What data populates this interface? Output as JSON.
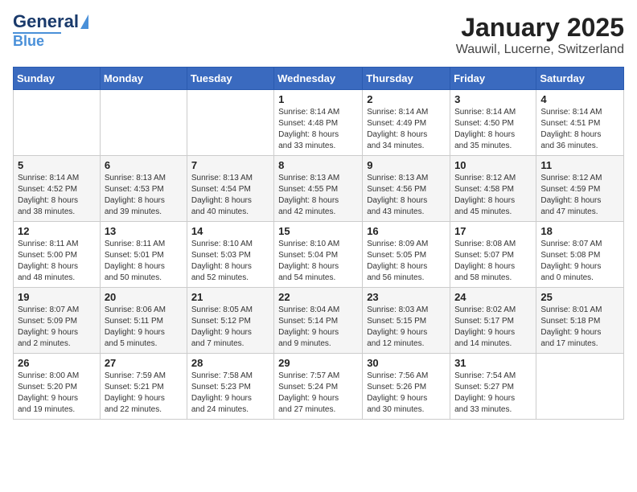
{
  "header": {
    "logo": {
      "line1": "General",
      "line2": "Blue"
    },
    "title": "January 2025",
    "subtitle": "Wauwil, Lucerne, Switzerland"
  },
  "weekdays": [
    "Sunday",
    "Monday",
    "Tuesday",
    "Wednesday",
    "Thursday",
    "Friday",
    "Saturday"
  ],
  "weeks": [
    [
      {
        "day": "",
        "info": ""
      },
      {
        "day": "",
        "info": ""
      },
      {
        "day": "",
        "info": ""
      },
      {
        "day": "1",
        "info": "Sunrise: 8:14 AM\nSunset: 4:48 PM\nDaylight: 8 hours\nand 33 minutes."
      },
      {
        "day": "2",
        "info": "Sunrise: 8:14 AM\nSunset: 4:49 PM\nDaylight: 8 hours\nand 34 minutes."
      },
      {
        "day": "3",
        "info": "Sunrise: 8:14 AM\nSunset: 4:50 PM\nDaylight: 8 hours\nand 35 minutes."
      },
      {
        "day": "4",
        "info": "Sunrise: 8:14 AM\nSunset: 4:51 PM\nDaylight: 8 hours\nand 36 minutes."
      }
    ],
    [
      {
        "day": "5",
        "info": "Sunrise: 8:14 AM\nSunset: 4:52 PM\nDaylight: 8 hours\nand 38 minutes."
      },
      {
        "day": "6",
        "info": "Sunrise: 8:13 AM\nSunset: 4:53 PM\nDaylight: 8 hours\nand 39 minutes."
      },
      {
        "day": "7",
        "info": "Sunrise: 8:13 AM\nSunset: 4:54 PM\nDaylight: 8 hours\nand 40 minutes."
      },
      {
        "day": "8",
        "info": "Sunrise: 8:13 AM\nSunset: 4:55 PM\nDaylight: 8 hours\nand 42 minutes."
      },
      {
        "day": "9",
        "info": "Sunrise: 8:13 AM\nSunset: 4:56 PM\nDaylight: 8 hours\nand 43 minutes."
      },
      {
        "day": "10",
        "info": "Sunrise: 8:12 AM\nSunset: 4:58 PM\nDaylight: 8 hours\nand 45 minutes."
      },
      {
        "day": "11",
        "info": "Sunrise: 8:12 AM\nSunset: 4:59 PM\nDaylight: 8 hours\nand 47 minutes."
      }
    ],
    [
      {
        "day": "12",
        "info": "Sunrise: 8:11 AM\nSunset: 5:00 PM\nDaylight: 8 hours\nand 48 minutes."
      },
      {
        "day": "13",
        "info": "Sunrise: 8:11 AM\nSunset: 5:01 PM\nDaylight: 8 hours\nand 50 minutes."
      },
      {
        "day": "14",
        "info": "Sunrise: 8:10 AM\nSunset: 5:03 PM\nDaylight: 8 hours\nand 52 minutes."
      },
      {
        "day": "15",
        "info": "Sunrise: 8:10 AM\nSunset: 5:04 PM\nDaylight: 8 hours\nand 54 minutes."
      },
      {
        "day": "16",
        "info": "Sunrise: 8:09 AM\nSunset: 5:05 PM\nDaylight: 8 hours\nand 56 minutes."
      },
      {
        "day": "17",
        "info": "Sunrise: 8:08 AM\nSunset: 5:07 PM\nDaylight: 8 hours\nand 58 minutes."
      },
      {
        "day": "18",
        "info": "Sunrise: 8:07 AM\nSunset: 5:08 PM\nDaylight: 9 hours\nand 0 minutes."
      }
    ],
    [
      {
        "day": "19",
        "info": "Sunrise: 8:07 AM\nSunset: 5:09 PM\nDaylight: 9 hours\nand 2 minutes."
      },
      {
        "day": "20",
        "info": "Sunrise: 8:06 AM\nSunset: 5:11 PM\nDaylight: 9 hours\nand 5 minutes."
      },
      {
        "day": "21",
        "info": "Sunrise: 8:05 AM\nSunset: 5:12 PM\nDaylight: 9 hours\nand 7 minutes."
      },
      {
        "day": "22",
        "info": "Sunrise: 8:04 AM\nSunset: 5:14 PM\nDaylight: 9 hours\nand 9 minutes."
      },
      {
        "day": "23",
        "info": "Sunrise: 8:03 AM\nSunset: 5:15 PM\nDaylight: 9 hours\nand 12 minutes."
      },
      {
        "day": "24",
        "info": "Sunrise: 8:02 AM\nSunset: 5:17 PM\nDaylight: 9 hours\nand 14 minutes."
      },
      {
        "day": "25",
        "info": "Sunrise: 8:01 AM\nSunset: 5:18 PM\nDaylight: 9 hours\nand 17 minutes."
      }
    ],
    [
      {
        "day": "26",
        "info": "Sunrise: 8:00 AM\nSunset: 5:20 PM\nDaylight: 9 hours\nand 19 minutes."
      },
      {
        "day": "27",
        "info": "Sunrise: 7:59 AM\nSunset: 5:21 PM\nDaylight: 9 hours\nand 22 minutes."
      },
      {
        "day": "28",
        "info": "Sunrise: 7:58 AM\nSunset: 5:23 PM\nDaylight: 9 hours\nand 24 minutes."
      },
      {
        "day": "29",
        "info": "Sunrise: 7:57 AM\nSunset: 5:24 PM\nDaylight: 9 hours\nand 27 minutes."
      },
      {
        "day": "30",
        "info": "Sunrise: 7:56 AM\nSunset: 5:26 PM\nDaylight: 9 hours\nand 30 minutes."
      },
      {
        "day": "31",
        "info": "Sunrise: 7:54 AM\nSunset: 5:27 PM\nDaylight: 9 hours\nand 33 minutes."
      },
      {
        "day": "",
        "info": ""
      }
    ]
  ]
}
